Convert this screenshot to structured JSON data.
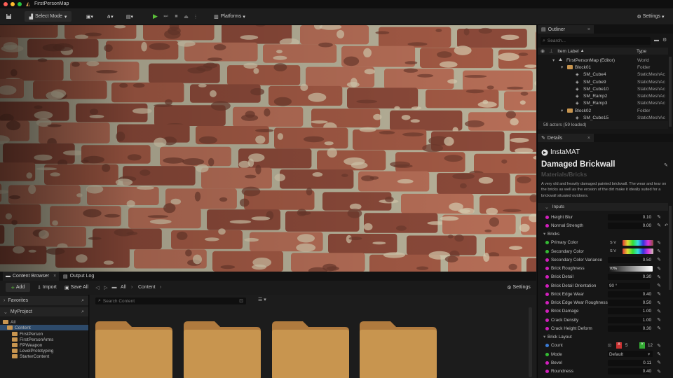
{
  "window": {
    "title": "FirstPersonMap"
  },
  "toolbar": {
    "select_mode": "Select Mode",
    "platforms": "Platforms",
    "settings": "Settings"
  },
  "content_browser": {
    "tabs": [
      "Content Browser",
      "Output Log"
    ],
    "add_label": "Add",
    "import_label": "Import",
    "save_all_label": "Save All",
    "path": [
      "All",
      "Content"
    ],
    "settings_label": "Settings",
    "favorites_label": "Favorites",
    "project_label": "MyProject",
    "search_placeholder": "Search Content",
    "tree": [
      "All",
      "Content",
      "FirstPerson",
      "FirstPersonArms",
      "FPWeapon",
      "LevelPrototyping",
      "StarterContent"
    ]
  },
  "outliner": {
    "tab": "Outliner",
    "search_placeholder": "Search...",
    "col_label": "Item Label",
    "col_type": "Type",
    "rows": [
      {
        "label": "FirstPersonMap (Editor)",
        "type": "World"
      },
      {
        "label": "Block01",
        "type": "Folder"
      },
      {
        "label": "SM_Cube4",
        "type": "StaticMeshAc"
      },
      {
        "label": "SM_Cube9",
        "type": "StaticMeshAc"
      },
      {
        "label": "SM_Cube10",
        "type": "StaticMeshAc"
      },
      {
        "label": "SM_Ramp2",
        "type": "StaticMeshAc"
      },
      {
        "label": "SM_Ramp3",
        "type": "StaticMeshAc"
      },
      {
        "label": "Block02",
        "type": "Folder"
      },
      {
        "label": "SM_Cube15",
        "type": "StaticMeshAc"
      }
    ],
    "status": "59 actors (59 loaded)"
  },
  "details": {
    "tab": "Details",
    "brand": "InstaMAT",
    "material_title": "Damaged Brickwall",
    "material_category": "Materials/Bricks",
    "description": "A very old and heavily damaged painted brickwall. The wear and tear on the bricks as well as the erosion of the dirt make it ideally suited for a brickwall situated outdoors.",
    "inputs_label": "Inputs",
    "rows": [
      {
        "label": "Height Blur",
        "value": "0.10"
      },
      {
        "label": "Normal Strength",
        "value": "0.00"
      },
      {
        "label": "Bricks",
        "value": ""
      },
      {
        "label": "Primary Color",
        "value": "S V"
      },
      {
        "label": "Secondary Color",
        "value": "S V"
      },
      {
        "label": "Secondary Color Variance",
        "value": "0.50"
      },
      {
        "label": "Brick Roughness",
        "value": "70%"
      },
      {
        "label": "Brick Detail",
        "value": "0.30"
      },
      {
        "label": "Brick Detail Orientation",
        "value": "90 °"
      },
      {
        "label": "Brick Edge Wear",
        "value": "0.40"
      },
      {
        "label": "Brick Edge Wear Roughness",
        "value": "0.50"
      },
      {
        "label": "Brick Damage",
        "value": "1.00"
      },
      {
        "label": "Crack Density",
        "value": "1.00"
      },
      {
        "label": "Crack Height Deform",
        "value": "0.30"
      },
      {
        "label": "Brick Layout",
        "value": ""
      },
      {
        "label": "Count",
        "value": "X 5 Y 12"
      },
      {
        "label": "Mode",
        "value": "Default"
      },
      {
        "label": "Bevel",
        "value": "0.11"
      },
      {
        "label": "Roundness",
        "value": "0.40"
      }
    ]
  },
  "colors": {
    "accent": "#5bc03a",
    "pin": "#d21fbd",
    "folder": "#c8954f"
  }
}
